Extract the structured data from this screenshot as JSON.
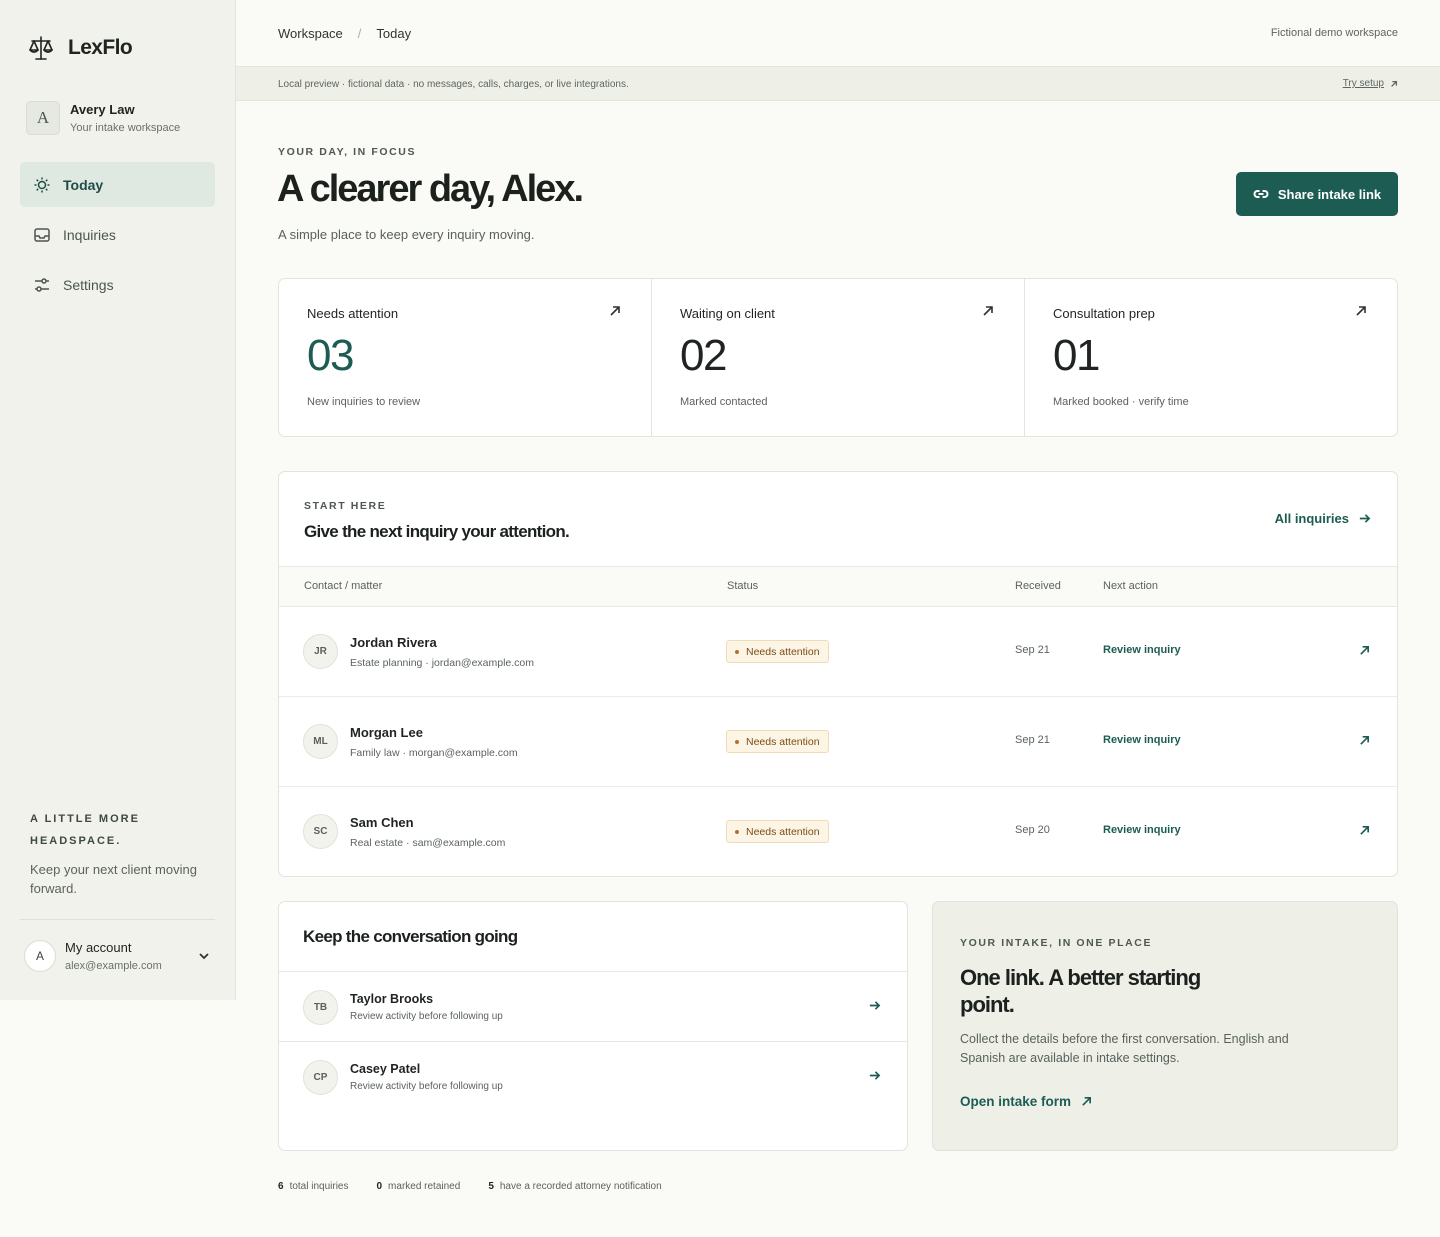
{
  "brand": {
    "name": "LexFlo"
  },
  "workspace": {
    "initial": "A",
    "name": "Avery Law",
    "subtitle": "Your intake workspace"
  },
  "nav": [
    {
      "label": "Today",
      "icon": "sun-icon",
      "active": true
    },
    {
      "label": "Inquiries",
      "icon": "inbox-icon",
      "active": false
    },
    {
      "label": "Settings",
      "icon": "sliders-icon",
      "active": false
    }
  ],
  "side_note": {
    "kicker_line1": "A LITTLE MORE",
    "kicker_line2": "HEADSPACE.",
    "text": "Keep your next client moving forward."
  },
  "account": {
    "initial": "A",
    "label": "My account",
    "email": "alex@example.com"
  },
  "breadcrumb": {
    "root": "Workspace",
    "separator": "/",
    "current": "Today"
  },
  "top_note": "Fictional demo workspace",
  "banner": {
    "text": "Local preview · fictional data · no messages, calls, charges, or live integrations.",
    "link": "Try setup"
  },
  "hero": {
    "kicker": "YOUR DAY, IN FOCUS",
    "title": "A clearer day, Alex.",
    "subtitle": "A simple place to keep every inquiry moving.",
    "button": "Share intake link"
  },
  "stats": [
    {
      "label": "Needs attention",
      "value": "03",
      "desc": "New inquiries to review"
    },
    {
      "label": "Waiting on client",
      "value": "02",
      "desc": "Marked contacted"
    },
    {
      "label": "Consultation prep",
      "value": "01",
      "desc": "Marked booked · verify time"
    }
  ],
  "inquiries": {
    "kicker": "START HERE",
    "title": "Give the next inquiry your attention.",
    "all_link": "All inquiries",
    "columns": [
      "Contact / matter",
      "Status",
      "Received",
      "Next action"
    ],
    "rows": [
      {
        "initials": "JR",
        "name": "Jordan Rivera",
        "sub": "Estate planning · jordan@example.com",
        "status": "Needs attention",
        "received": "Sep 21",
        "action": "Review inquiry"
      },
      {
        "initials": "ML",
        "name": "Morgan Lee",
        "sub": "Family law · morgan@example.com",
        "status": "Needs attention",
        "received": "Sep 21",
        "action": "Review inquiry"
      },
      {
        "initials": "SC",
        "name": "Sam Chen",
        "sub": "Real estate · sam@example.com",
        "status": "Needs attention",
        "received": "Sep 20",
        "action": "Review inquiry"
      }
    ]
  },
  "conversation": {
    "title": "Keep the conversation going",
    "items": [
      {
        "initials": "TB",
        "name": "Taylor Brooks",
        "sub": "Review activity before following up"
      },
      {
        "initials": "CP",
        "name": "Casey Patel",
        "sub": "Review activity before following up"
      }
    ]
  },
  "intake": {
    "kicker": "YOUR INTAKE, IN ONE PLACE",
    "title": "One link. A better starting point.",
    "text": "Collect the details before the first conversation. English and Spanish are available in intake settings.",
    "link": "Open intake form"
  },
  "footer": [
    {
      "count": "6",
      "label": "total inquiries"
    },
    {
      "count": "0",
      "label": "marked retained"
    },
    {
      "count": "5",
      "label": "have a recorded attorney notification"
    }
  ],
  "colors": {
    "accent": "#1d5c52",
    "sidebar": "#f1f2ec",
    "background": "#fafaf6",
    "badge_bg": "#fcf4e4",
    "badge_text": "#7a4e18"
  }
}
